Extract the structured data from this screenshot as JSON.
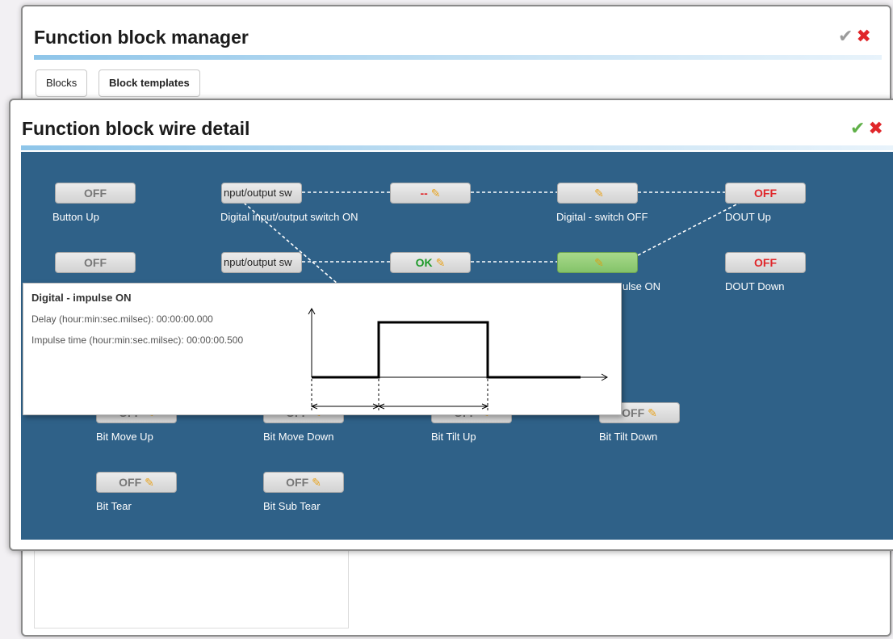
{
  "back_window": {
    "title": "Function block manager",
    "tabs": [
      {
        "label": "Blocks",
        "active": false
      },
      {
        "label": "Block templates",
        "active": true
      }
    ]
  },
  "front_window": {
    "title": "Function block wire detail"
  },
  "icons": {
    "confirm": "✔",
    "close": "✖",
    "pencil": "✎"
  },
  "colors": {
    "canvas": "#2f6188",
    "off_red": "#e0262a",
    "ok_green": "#1e9a2a",
    "active_block": "#93cd74",
    "title_underline": "#8ec5e9"
  },
  "blocks": {
    "button_up": {
      "value": "OFF",
      "label": "Button Up"
    },
    "switch_on_top": {
      "value": "nput/output sw",
      "label": "Digital input/output switch ON"
    },
    "dash_block": {
      "value": "--"
    },
    "switch_off": {
      "label": "Digital - switch OFF"
    },
    "dout_up": {
      "value": "OFF",
      "label": "DOUT Up"
    },
    "button_down": {
      "value": "OFF"
    },
    "switch_on_mid": {
      "value": "nput/output sw"
    },
    "ok_block": {
      "value": "OK"
    },
    "impulse_on": {
      "label": "ulse ON"
    },
    "dout_down": {
      "value": "OFF",
      "label": "DOUT Down"
    },
    "bit_move_up": {
      "value": "OFF",
      "label": "Bit Move Up"
    },
    "bit_move_down": {
      "value": "OFF",
      "label": "Bit Move Down"
    },
    "bit_tilt_up": {
      "value": "OFF",
      "label": "Bit Tilt Up"
    },
    "bit_tilt_down": {
      "value": "OFF",
      "label": "Bit Tilt Down"
    },
    "bit_tear": {
      "value": "OFF",
      "label": "Bit Tear"
    },
    "bit_sub_tear": {
      "value": "OFF",
      "label": "Bit Sub Tear"
    }
  },
  "tooltip": {
    "title": "Digital - impulse ON",
    "delay_label": "Delay (hour:min:sec.milsec):",
    "delay_value": "00:00:00.000",
    "impulse_label": "Impulse time (hour:min:sec.milsec):",
    "impulse_value": "00:00:00.500"
  }
}
